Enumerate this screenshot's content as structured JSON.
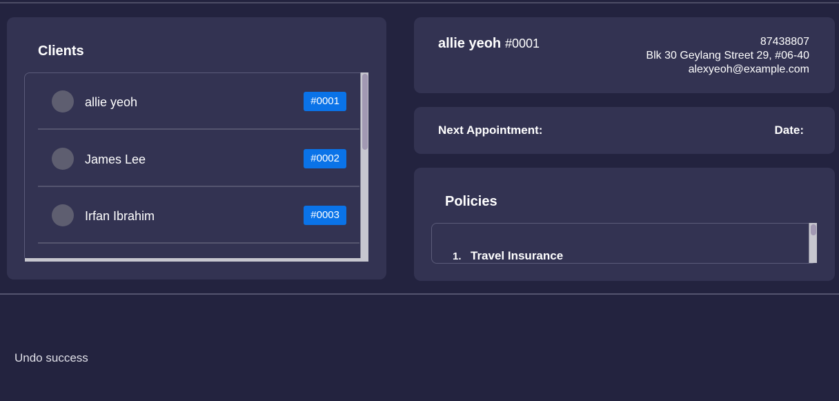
{
  "clients_panel": {
    "title": "Clients",
    "clients": [
      {
        "name": "allie yeoh",
        "id": "#0001"
      },
      {
        "name": "James Lee",
        "id": "#0002"
      },
      {
        "name": "Irfan Ibrahim",
        "id": "#0003"
      }
    ]
  },
  "person": {
    "name": "allie yeoh",
    "id": "#0001",
    "phone": "87438807",
    "address": "Blk 30 Geylang Street 29, #06-40",
    "email": "alexyeoh@example.com"
  },
  "appointment": {
    "label": "Next Appointment:",
    "date_label": "Date:"
  },
  "policies_panel": {
    "title": "Policies",
    "policies": [
      {
        "number": "1.",
        "name": "Travel Insurance"
      }
    ]
  },
  "result": {
    "message": "Undo success"
  },
  "colors": {
    "background": "#23233f",
    "panel": "#333352",
    "id_badge": "#0a73e8"
  }
}
